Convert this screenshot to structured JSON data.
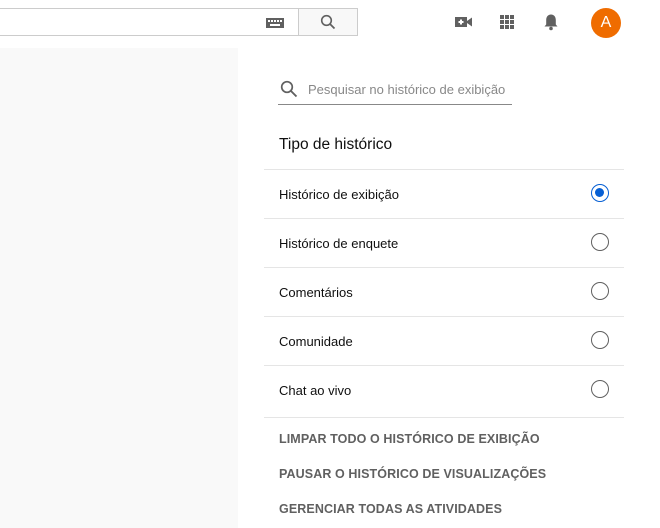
{
  "header": {
    "search_input_value": "",
    "avatar_letter": "A",
    "icons": [
      "keyboard-icon",
      "search-icon",
      "video-camera-add-icon",
      "apps-grid-icon",
      "notifications-bell-icon"
    ]
  },
  "history_panel": {
    "search_placeholder": "Pesquisar no histórico de exibição",
    "section_title": "Tipo de histórico",
    "options": [
      {
        "label": "Histórico de exibição",
        "selected": true
      },
      {
        "label": "Histórico de enquete",
        "selected": false
      },
      {
        "label": "Comentários",
        "selected": false
      },
      {
        "label": "Comunidade",
        "selected": false
      },
      {
        "label": "Chat ao vivo",
        "selected": false
      }
    ],
    "actions": [
      "LIMPAR TODO O HISTÓRICO DE EXIBIÇÃO",
      "PAUSAR O HISTÓRICO DE VISUALIZAÇÕES",
      "GERENCIAR TODAS AS ATIVIDADES"
    ]
  },
  "colors": {
    "accent": "#065fd4",
    "avatar": "#ef6c00"
  }
}
